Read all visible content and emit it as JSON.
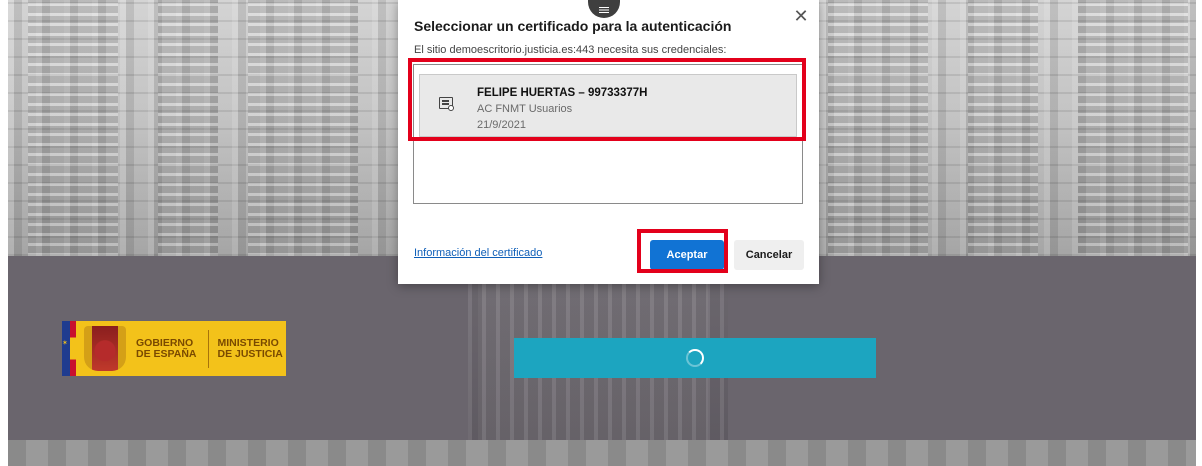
{
  "dialog": {
    "title": "Seleccionar un certificado para la autenticación",
    "subtitle": "El sitio demoescritorio.justicia.es:443 necesita sus credenciales:",
    "close_icon": "close-icon",
    "grip_icon": "menu-grip-icon",
    "certificates": [
      {
        "name": "FELIPE HUERTAS – 99733377H",
        "issuer": "AC FNMT Usuarios",
        "date": "21/9/2021",
        "icon": "certificate-icon"
      }
    ],
    "info_link": "Información del certificado",
    "accept_label": "Aceptar",
    "cancel_label": "Cancelar"
  },
  "logo": {
    "gobierno_line1": "GOBIERNO",
    "gobierno_line2": "DE ESPAÑA",
    "ministerio_line1": "MINISTERIO",
    "ministerio_line2": "DE JUSTICIA"
  },
  "loader": {
    "icon": "loading-spinner-icon"
  },
  "colors": {
    "accept_button": "#1173d4",
    "link": "#0f5fb8",
    "highlight": "#e3001b",
    "loader_bar": "#1ca5c0",
    "logo_bg": "#f3c21a"
  }
}
